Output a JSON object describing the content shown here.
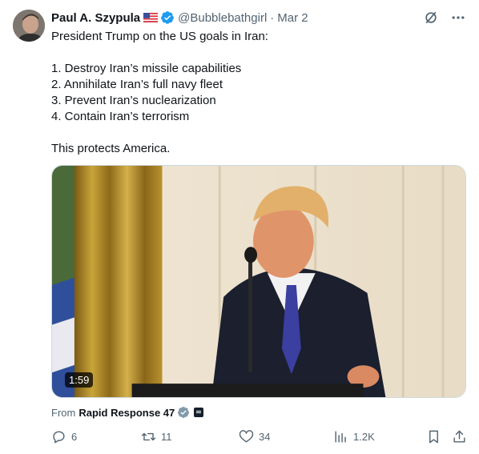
{
  "author": {
    "name": "Paul A. Szypula",
    "handle": "@Bubblebathgirl",
    "separator": "·",
    "date": "Mar 2"
  },
  "tweet": {
    "lines": [
      "President Trump on the US goals in Iran:",
      "1. Destroy Iran’s missile capabilities",
      "2. Annihilate Iran’s full navy fleet",
      "3. Prevent Iran’s nuclearization",
      "4. Contain Iran’s terrorism",
      "This protects America."
    ]
  },
  "media": {
    "duration": "1:59"
  },
  "source": {
    "prefix": "From",
    "name": "Rapid Response 47"
  },
  "actions": {
    "replies": "6",
    "reposts": "11",
    "likes": "34",
    "views": "1.2K"
  },
  "colors": {
    "verified": "#1d9bf0",
    "muted": "#536471",
    "text": "#0f1419"
  },
  "icons": [
    "grok-icon",
    "more-icon",
    "reply-icon",
    "retweet-icon",
    "heart-icon",
    "views-icon",
    "bookmark-icon",
    "share-icon"
  ]
}
